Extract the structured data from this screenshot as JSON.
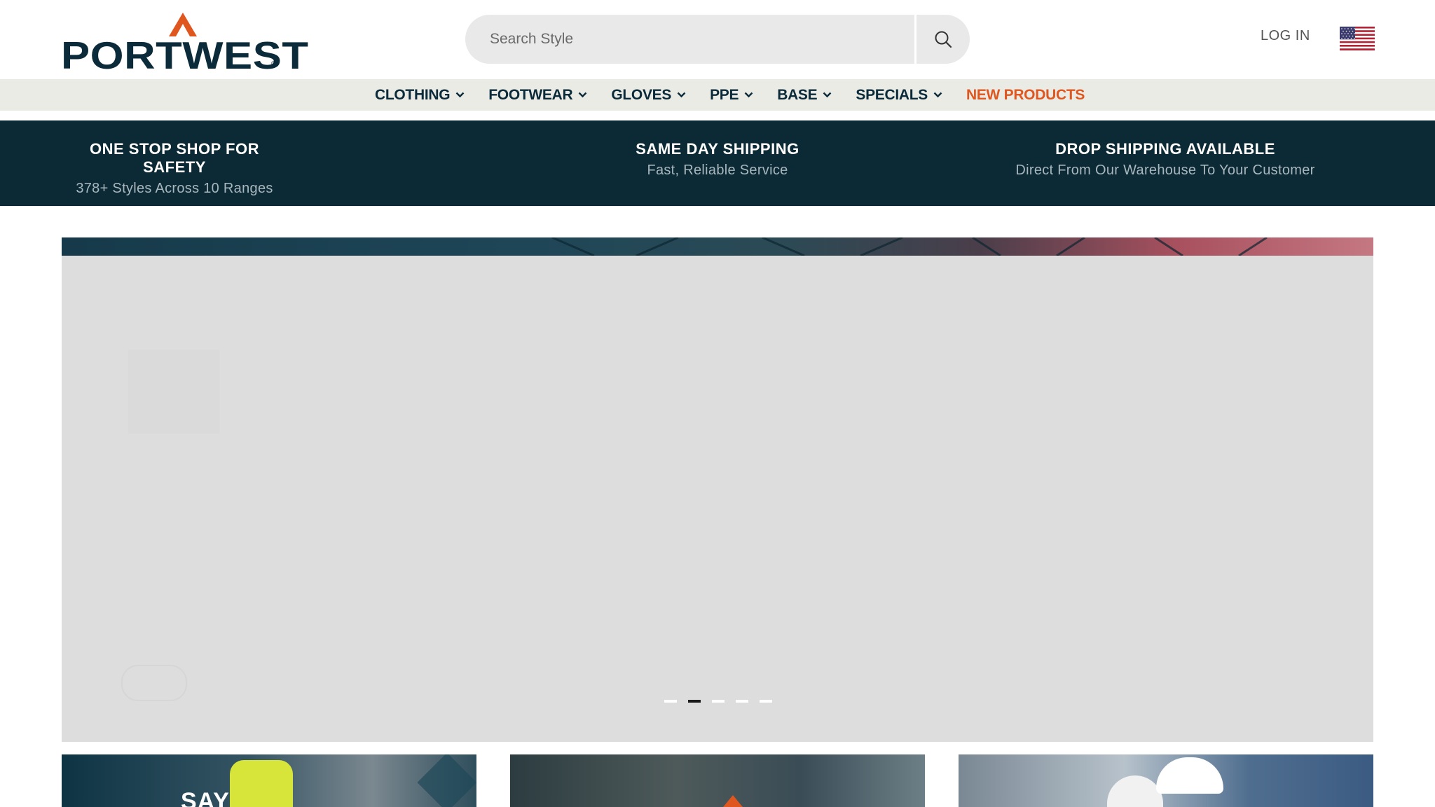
{
  "header": {
    "logo_text": "PORTWEST",
    "logo_reg": "®",
    "search": {
      "placeholder": "Search Style",
      "value": ""
    },
    "login_label": "LOG IN",
    "flag": "us-flag-icon"
  },
  "nav": {
    "items": [
      {
        "label": "CLOTHING",
        "has_dropdown": true
      },
      {
        "label": "FOOTWEAR",
        "has_dropdown": true
      },
      {
        "label": "GLOVES",
        "has_dropdown": true
      },
      {
        "label": "PPE",
        "has_dropdown": true
      },
      {
        "label": "BASE",
        "has_dropdown": true
      },
      {
        "label": "SPECIALS",
        "has_dropdown": true
      },
      {
        "label": "NEW PRODUCTS",
        "has_dropdown": false,
        "color": "#e0561f"
      }
    ]
  },
  "usp": [
    {
      "title": "ONE STOP SHOP FOR SAFETY",
      "subtitle": "378+ Styles Across 10 Ranges"
    },
    {
      "title": "SAME DAY SHIPPING",
      "subtitle": "Fast, Reliable Service"
    },
    {
      "title": "DROP SHIPPING AVAILABLE",
      "subtitle": "Direct From Our Warehouse To Your Customer"
    }
  ],
  "hero": {
    "carousel_count": 5,
    "active_index": 1
  },
  "cards": [
    {
      "text": "SAY"
    },
    {
      "text": ""
    },
    {
      "text": ""
    }
  ],
  "colors": {
    "brand_navy": "#0b2a3a",
    "accent_orange": "#e0561f",
    "usp_bar": "#0b2a36",
    "nav_bg": "#ebebe6"
  }
}
